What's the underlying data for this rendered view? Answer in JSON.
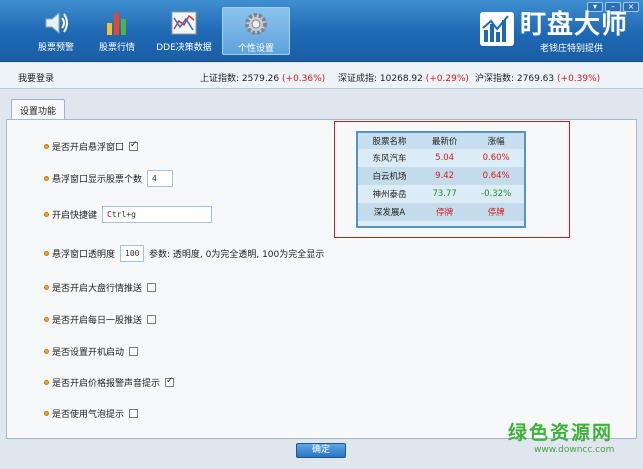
{
  "nav": [
    {
      "label": "股票预警",
      "icon": "speaker-icon"
    },
    {
      "label": "股票行情",
      "icon": "bar-chart-icon"
    },
    {
      "label": "DDE决策数据",
      "icon": "line-chart-icon"
    },
    {
      "label": "个性设置",
      "icon": "gear-icon"
    }
  ],
  "logo": {
    "title": "盯盘大师",
    "subtitle": "老钱庄特别提供"
  },
  "status": {
    "my_login": "我要登录",
    "sh_label": "上证指数:",
    "sh_value": "2579.26",
    "sh_change": "(+0.36%)",
    "sz_label": "深证成指:",
    "sz_value": "10268.92",
    "sz_change": "(+0.29%)",
    "hs_label": "沪深指数:",
    "hs_value": "2769.63",
    "hs_change": "(+0.39%)"
  },
  "tab": {
    "label": "设置功能"
  },
  "settings": {
    "float_window": {
      "label": "是否开启悬浮窗口",
      "checked": true
    },
    "stock_count": {
      "label": "悬浮窗口显示股票个数",
      "value": "4"
    },
    "hotkey": {
      "label": "开启快捷键",
      "value": "Ctrl+g"
    },
    "opacity": {
      "label": "悬浮窗口透明度",
      "value": "100",
      "note": "参数: 透明度, 0为完全透明, 100为完全显示"
    },
    "market_push": {
      "label": "是否开启大盘行情推送",
      "checked": false
    },
    "daily_push": {
      "label": "是否开启每日一股推送",
      "checked": false
    },
    "autostart": {
      "label": "是否设置开机启动",
      "checked": false
    },
    "alert_sound": {
      "label": "是否开启价格报警声音提示",
      "checked": true
    },
    "bubble": {
      "label": "是否使用气泡提示",
      "checked": false
    }
  },
  "preview": {
    "headers": [
      "股票名称",
      "最新价",
      "涨幅"
    ],
    "rows": [
      {
        "name": "东风汽车",
        "price": "5.04",
        "change": "0.60%",
        "color": "#d31a1a"
      },
      {
        "name": "白云机场",
        "price": "9.42",
        "change": "0.64%",
        "color": "#d31a1a"
      },
      {
        "name": "神州泰岳",
        "price": "73.77",
        "change": "-0.32%",
        "color": "#1f8e1f"
      },
      {
        "name": "深发展A",
        "price": "停牌",
        "change": "停牌",
        "color": "#d31a1a"
      }
    ]
  },
  "buttons": {
    "ok": "确定"
  },
  "watermark": {
    "big": "绿色资源网",
    "small": "www.downcc.com"
  }
}
